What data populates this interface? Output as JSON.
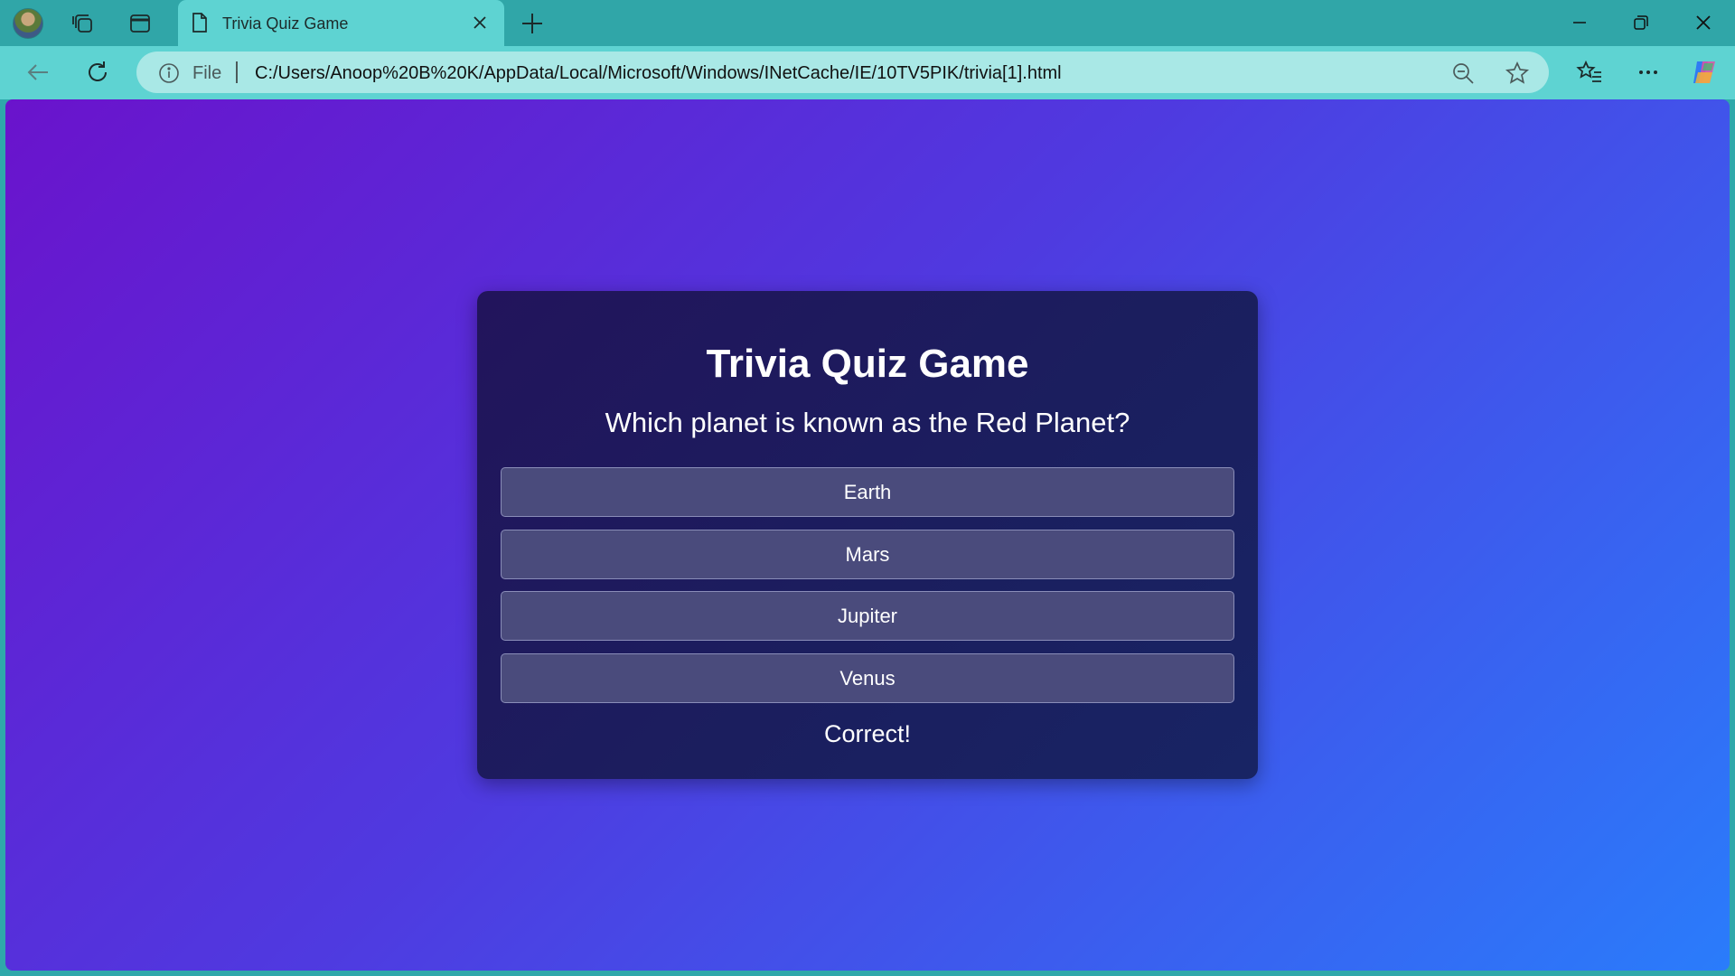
{
  "browser": {
    "tab_title": "Trivia Quiz Game",
    "address_scheme": "File",
    "address_url": "C:/Users/Anoop%20B%20K/AppData/Local/Microsoft/Windows/INetCache/IE/10TV5PIK/trivia[1].html",
    "icons": [
      "profile-avatar",
      "workspaces-icon",
      "tab-actions-icon",
      "page-icon",
      "close-icon",
      "plus-icon",
      "minimize-icon",
      "restore-icon",
      "window-close-icon",
      "back-icon",
      "refresh-icon",
      "info-icon",
      "zoom-out-icon",
      "star-icon",
      "favorites-icon",
      "more-icon",
      "copilot-icon"
    ],
    "colors": {
      "frame": "#30a6a8",
      "toolbar": "#5ed3d2",
      "address_bar": "#a9e8e6"
    }
  },
  "quiz": {
    "title": "Trivia Quiz Game",
    "question": "Which planet is known as the Red Planet?",
    "answers": [
      "Earth",
      "Mars",
      "Jupiter",
      "Venus"
    ],
    "feedback": "Correct!",
    "colors": {
      "background_start": "#6a13cc",
      "background_end": "#2a7cfb",
      "card": "#1d1a5e",
      "answer_button": "#4a4b7c"
    }
  }
}
